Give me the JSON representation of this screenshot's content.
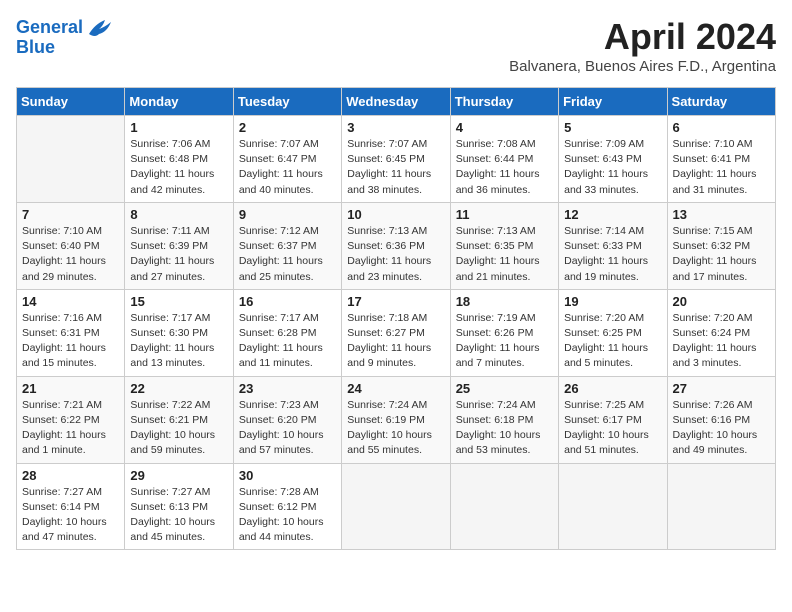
{
  "header": {
    "logo_line1": "General",
    "logo_line2": "Blue",
    "month_title": "April 2024",
    "subtitle": "Balvanera, Buenos Aires F.D., Argentina"
  },
  "weekdays": [
    "Sunday",
    "Monday",
    "Tuesday",
    "Wednesday",
    "Thursday",
    "Friday",
    "Saturday"
  ],
  "weeks": [
    [
      {
        "day": "",
        "info": ""
      },
      {
        "day": "1",
        "info": "Sunrise: 7:06 AM\nSunset: 6:48 PM\nDaylight: 11 hours\nand 42 minutes."
      },
      {
        "day": "2",
        "info": "Sunrise: 7:07 AM\nSunset: 6:47 PM\nDaylight: 11 hours\nand 40 minutes."
      },
      {
        "day": "3",
        "info": "Sunrise: 7:07 AM\nSunset: 6:45 PM\nDaylight: 11 hours\nand 38 minutes."
      },
      {
        "day": "4",
        "info": "Sunrise: 7:08 AM\nSunset: 6:44 PM\nDaylight: 11 hours\nand 36 minutes."
      },
      {
        "day": "5",
        "info": "Sunrise: 7:09 AM\nSunset: 6:43 PM\nDaylight: 11 hours\nand 33 minutes."
      },
      {
        "day": "6",
        "info": "Sunrise: 7:10 AM\nSunset: 6:41 PM\nDaylight: 11 hours\nand 31 minutes."
      }
    ],
    [
      {
        "day": "7",
        "info": "Sunrise: 7:10 AM\nSunset: 6:40 PM\nDaylight: 11 hours\nand 29 minutes."
      },
      {
        "day": "8",
        "info": "Sunrise: 7:11 AM\nSunset: 6:39 PM\nDaylight: 11 hours\nand 27 minutes."
      },
      {
        "day": "9",
        "info": "Sunrise: 7:12 AM\nSunset: 6:37 PM\nDaylight: 11 hours\nand 25 minutes."
      },
      {
        "day": "10",
        "info": "Sunrise: 7:13 AM\nSunset: 6:36 PM\nDaylight: 11 hours\nand 23 minutes."
      },
      {
        "day": "11",
        "info": "Sunrise: 7:13 AM\nSunset: 6:35 PM\nDaylight: 11 hours\nand 21 minutes."
      },
      {
        "day": "12",
        "info": "Sunrise: 7:14 AM\nSunset: 6:33 PM\nDaylight: 11 hours\nand 19 minutes."
      },
      {
        "day": "13",
        "info": "Sunrise: 7:15 AM\nSunset: 6:32 PM\nDaylight: 11 hours\nand 17 minutes."
      }
    ],
    [
      {
        "day": "14",
        "info": "Sunrise: 7:16 AM\nSunset: 6:31 PM\nDaylight: 11 hours\nand 15 minutes."
      },
      {
        "day": "15",
        "info": "Sunrise: 7:17 AM\nSunset: 6:30 PM\nDaylight: 11 hours\nand 13 minutes."
      },
      {
        "day": "16",
        "info": "Sunrise: 7:17 AM\nSunset: 6:28 PM\nDaylight: 11 hours\nand 11 minutes."
      },
      {
        "day": "17",
        "info": "Sunrise: 7:18 AM\nSunset: 6:27 PM\nDaylight: 11 hours\nand 9 minutes."
      },
      {
        "day": "18",
        "info": "Sunrise: 7:19 AM\nSunset: 6:26 PM\nDaylight: 11 hours\nand 7 minutes."
      },
      {
        "day": "19",
        "info": "Sunrise: 7:20 AM\nSunset: 6:25 PM\nDaylight: 11 hours\nand 5 minutes."
      },
      {
        "day": "20",
        "info": "Sunrise: 7:20 AM\nSunset: 6:24 PM\nDaylight: 11 hours\nand 3 minutes."
      }
    ],
    [
      {
        "day": "21",
        "info": "Sunrise: 7:21 AM\nSunset: 6:22 PM\nDaylight: 11 hours\nand 1 minute."
      },
      {
        "day": "22",
        "info": "Sunrise: 7:22 AM\nSunset: 6:21 PM\nDaylight: 10 hours\nand 59 minutes."
      },
      {
        "day": "23",
        "info": "Sunrise: 7:23 AM\nSunset: 6:20 PM\nDaylight: 10 hours\nand 57 minutes."
      },
      {
        "day": "24",
        "info": "Sunrise: 7:24 AM\nSunset: 6:19 PM\nDaylight: 10 hours\nand 55 minutes."
      },
      {
        "day": "25",
        "info": "Sunrise: 7:24 AM\nSunset: 6:18 PM\nDaylight: 10 hours\nand 53 minutes."
      },
      {
        "day": "26",
        "info": "Sunrise: 7:25 AM\nSunset: 6:17 PM\nDaylight: 10 hours\nand 51 minutes."
      },
      {
        "day": "27",
        "info": "Sunrise: 7:26 AM\nSunset: 6:16 PM\nDaylight: 10 hours\nand 49 minutes."
      }
    ],
    [
      {
        "day": "28",
        "info": "Sunrise: 7:27 AM\nSunset: 6:14 PM\nDaylight: 10 hours\nand 47 minutes."
      },
      {
        "day": "29",
        "info": "Sunrise: 7:27 AM\nSunset: 6:13 PM\nDaylight: 10 hours\nand 45 minutes."
      },
      {
        "day": "30",
        "info": "Sunrise: 7:28 AM\nSunset: 6:12 PM\nDaylight: 10 hours\nand 44 minutes."
      },
      {
        "day": "",
        "info": ""
      },
      {
        "day": "",
        "info": ""
      },
      {
        "day": "",
        "info": ""
      },
      {
        "day": "",
        "info": ""
      }
    ]
  ]
}
